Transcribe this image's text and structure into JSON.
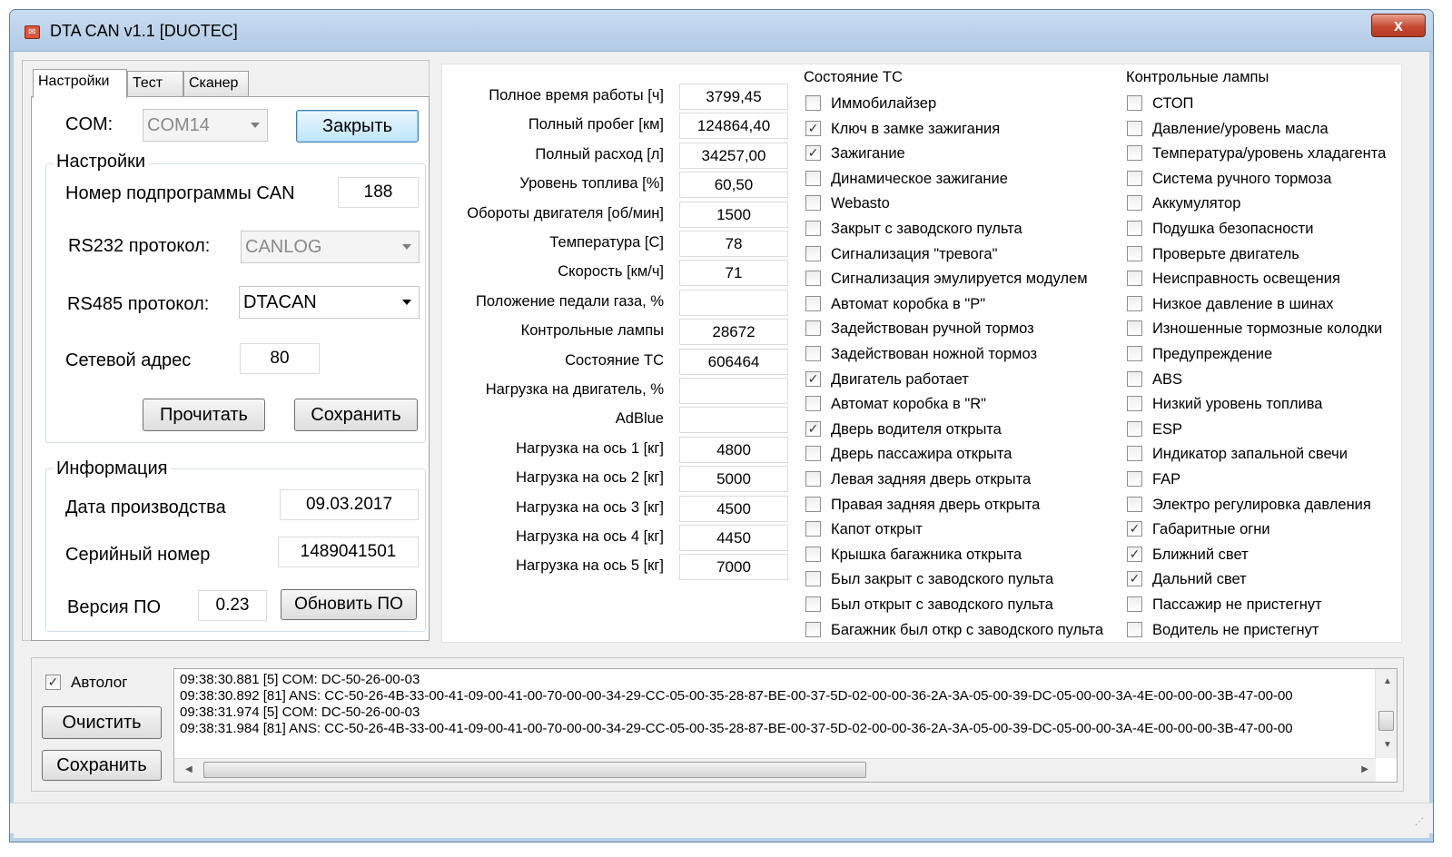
{
  "window": {
    "title": "DTA CAN v1.1  [DUOTEC]",
    "close_glyph": "x"
  },
  "tabs": [
    "Настройки",
    "Тест",
    "Сканер"
  ],
  "com": {
    "label": "COM:",
    "value": "COM14",
    "close_button": "Закрыть"
  },
  "settings": {
    "title": "Настройки",
    "subprogram_label": "Номер подпрограммы CAN",
    "subprogram_value": "188",
    "rs232_label": "RS232 протокол:",
    "rs232_value": "CANLOG",
    "rs485_label": "RS485 протокол:",
    "rs485_value": "DTACAN",
    "net_label": "Сетевой адрес",
    "net_value": "80",
    "read_button": "Прочитать",
    "save_button": "Сохранить"
  },
  "info": {
    "title": "Информация",
    "date_label": "Дата производства",
    "date_value": "09.03.2017",
    "serial_label": "Серийный номер",
    "serial_value": "1489041501",
    "fw_label": "Версия ПО",
    "fw_value": "0.23",
    "update_button": "Обновить ПО"
  },
  "params": [
    {
      "label": "Полное время работы [ч]",
      "value": "3799,45"
    },
    {
      "label": "Полный пробег [км]",
      "value": "124864,40"
    },
    {
      "label": "Полный расход [л]",
      "value": "34257,00"
    },
    {
      "label": "Уровень топлива [%]",
      "value": "60,50"
    },
    {
      "label": "Обороты двигателя [об/мин]",
      "value": "1500"
    },
    {
      "label": "Температура [С]",
      "value": "78"
    },
    {
      "label": "Скорость [км/ч]",
      "value": "71"
    },
    {
      "label": "Положение педали газа, %",
      "value": ""
    },
    {
      "label": "Контрольные лампы",
      "value": "28672"
    },
    {
      "label": "Состояние ТС",
      "value": "606464"
    },
    {
      "label": "Нагрузка на двигатель, %",
      "value": ""
    },
    {
      "label": "AdBlue",
      "value": ""
    },
    {
      "label": "Нагрузка на ось 1 [кг]",
      "value": "4800"
    },
    {
      "label": "Нагрузка на ось 2 [кг]",
      "value": "5000"
    },
    {
      "label": "Нагрузка на ось 3 [кг]",
      "value": "4500"
    },
    {
      "label": "Нагрузка на ось 4 [кг]",
      "value": "4450"
    },
    {
      "label": "Нагрузка на ось 5 [кг]",
      "value": "7000"
    }
  ],
  "vehicle_state": {
    "title": "Состояние ТС",
    "items": [
      {
        "label": "Иммобилайзер",
        "checked": false
      },
      {
        "label": "Ключ в замке зажигания",
        "checked": true
      },
      {
        "label": "Зажигание",
        "checked": true
      },
      {
        "label": "Динамическое зажигание",
        "checked": false
      },
      {
        "label": "Webasto",
        "checked": false
      },
      {
        "label": "Закрыт с заводского пульта",
        "checked": false
      },
      {
        "label": "Сигнализация \"тревога\"",
        "checked": false
      },
      {
        "label": "Сигнализация эмулируется модулем",
        "checked": false
      },
      {
        "label": "Автомат коробка в \"P\"",
        "checked": false
      },
      {
        "label": "Задействован ручной тормоз",
        "checked": false
      },
      {
        "label": "Задействован ножной тормоз",
        "checked": false
      },
      {
        "label": "Двигатель работает",
        "checked": true
      },
      {
        "label": "Автомат коробка в \"R\"",
        "checked": false
      },
      {
        "label": "Дверь водителя открыта",
        "checked": true
      },
      {
        "label": "Дверь пассажира открыта",
        "checked": false
      },
      {
        "label": "Левая задняя дверь открыта",
        "checked": false
      },
      {
        "label": "Правая задняя дверь открыта",
        "checked": false
      },
      {
        "label": "Капот открыт",
        "checked": false
      },
      {
        "label": "Крышка багажника открыта",
        "checked": false
      },
      {
        "label": "Был закрыт с заводского пульта",
        "checked": false
      },
      {
        "label": "Был открыт с заводского пульта",
        "checked": false
      },
      {
        "label": "Багажник был откр с заводского пульта",
        "checked": false
      }
    ]
  },
  "warning_lamps": {
    "title": "Контрольные лампы",
    "items": [
      {
        "label": "СТОП",
        "checked": false
      },
      {
        "label": "Давление/уровень масла",
        "checked": false
      },
      {
        "label": "Температура/уровень хладагента",
        "checked": false
      },
      {
        "label": "Система ручного тормоза",
        "checked": false
      },
      {
        "label": "Аккумулятор",
        "checked": false
      },
      {
        "label": "Подушка безопасности",
        "checked": false
      },
      {
        "label": "Проверьте двигатель",
        "checked": false
      },
      {
        "label": "Неисправность освещения",
        "checked": false
      },
      {
        "label": "Низкое давление в шинах",
        "checked": false
      },
      {
        "label": "Изношенные тормозные колодки",
        "checked": false
      },
      {
        "label": "Предупреждение",
        "checked": false
      },
      {
        "label": "ABS",
        "checked": false
      },
      {
        "label": "Низкий уровень топлива",
        "checked": false
      },
      {
        "label": "ESP",
        "checked": false
      },
      {
        "label": "Индикатор запальной свечи",
        "checked": false
      },
      {
        "label": "FAP",
        "checked": false
      },
      {
        "label": "Электро регулировка давления",
        "checked": false
      },
      {
        "label": "Габаритные огни",
        "checked": true
      },
      {
        "label": "Ближний свет",
        "checked": true
      },
      {
        "label": "Дальний свет",
        "checked": true
      },
      {
        "label": "Пассажир не пристегнут",
        "checked": false
      },
      {
        "label": "Водитель не пристегнут",
        "checked": false
      }
    ]
  },
  "log": {
    "autolog_label": "Автолог",
    "autolog_checked": true,
    "clear_button": "Очистить",
    "save_button": "Сохранить",
    "lines": [
      "09:38:30.881 [5] COM:    DC-50-26-00-03",
      "09:38:30.892 [81] ANS:    CC-50-26-4B-33-00-41-09-00-41-00-70-00-00-34-29-CC-05-00-35-28-87-BE-00-37-5D-02-00-00-36-2A-3A-05-00-39-DC-05-00-00-3A-4E-00-00-00-3B-47-00-00",
      "09:38:31.974 [5] COM:    DC-50-26-00-03",
      "09:38:31.984 [81] ANS:    CC-50-26-4B-33-00-41-09-00-41-00-70-00-00-34-29-CC-05-00-35-28-87-BE-00-37-5D-02-00-00-36-2A-3A-05-00-39-DC-05-00-00-3A-4E-00-00-00-3B-47-00-00"
    ]
  }
}
